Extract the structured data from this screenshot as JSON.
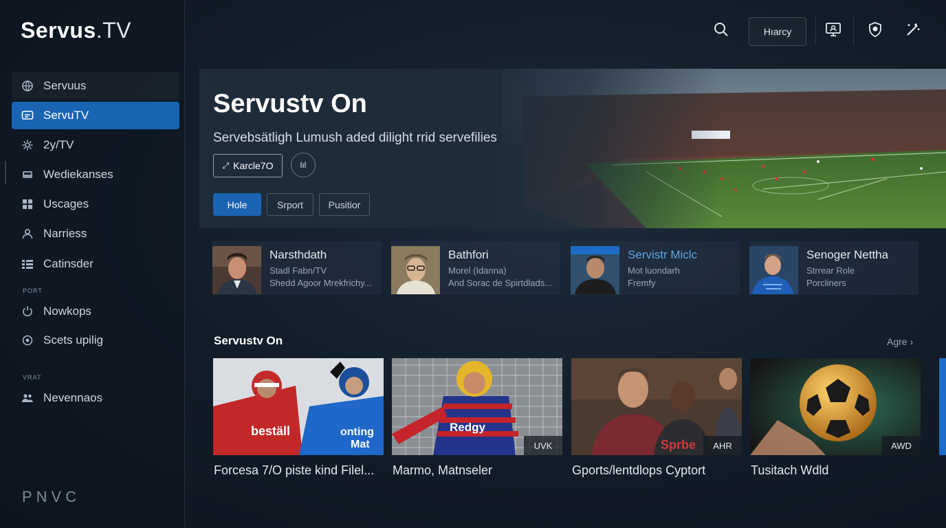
{
  "app": {
    "logo_bold": "Servus",
    "logo_light": ".TV"
  },
  "sidebar": {
    "items": [
      {
        "label": "Servuus",
        "icon": "globe-icon"
      },
      {
        "label": "ServuTV",
        "icon": "tv-icon",
        "active": true
      },
      {
        "label": "2y/TV",
        "icon": "gear-icon"
      },
      {
        "label": "Wediekanses",
        "icon": "bed-icon"
      },
      {
        "label": "Uscages",
        "icon": "grid-icon"
      },
      {
        "label": "Narriess",
        "icon": "person-icon"
      },
      {
        "label": "Catinsder",
        "icon": "list-icon"
      }
    ],
    "section1_label": "PORT",
    "section1_items": [
      {
        "label": "Nowkops",
        "icon": "power-icon"
      },
      {
        "label": "Scets upilig",
        "icon": "settings-icon"
      }
    ],
    "section2_label": "VRAT",
    "section2_items": [
      {
        "label": "Nevennaos",
        "icon": "people-icon"
      }
    ],
    "footer": "PNVC"
  },
  "topbar": {
    "history_label": "Hıarcy"
  },
  "hero": {
    "title": "Servustv On",
    "subtitle": "Servebsätligh Lumush aded dilight rrid servefilies",
    "primary_btn": "Karcle7O",
    "secondary_btn": "lıl",
    "chips": [
      "Hole",
      "Srport",
      "Pusitior"
    ],
    "active_chip": 0
  },
  "people": [
    {
      "name": "Narsthdath",
      "line1": "Stadl Fabn/TV",
      "line2": "Shedd Agoor Mrekfrichy..."
    },
    {
      "name": "Bathfori",
      "line1": "Morel (Idanna)",
      "line2": "And Sorac de Spirtdlads..."
    },
    {
      "name": "Servistr Miclc",
      "line1": "Mot luondarh",
      "line2": "Fremfy"
    },
    {
      "name": "Senoger Nettha",
      "line1": "Strrear Role",
      "line2": "Porcliners"
    }
  ],
  "section": {
    "title": "Servustv On",
    "more": "Agre ›"
  },
  "tiles": [
    {
      "caption": "Forcesa 7/O piste kind Filel...",
      "badge": ""
    },
    {
      "caption": "Marmo, Matnseler",
      "badge": "UVK"
    },
    {
      "caption": "Gports/lentdlops Cyptort",
      "badge": "AHR"
    },
    {
      "caption": "Tusitach Wdld",
      "badge": "AWD"
    }
  ],
  "colors": {
    "accent": "#1a64b4",
    "background": "#121c28",
    "highlight_name": "#5fa6e6"
  }
}
